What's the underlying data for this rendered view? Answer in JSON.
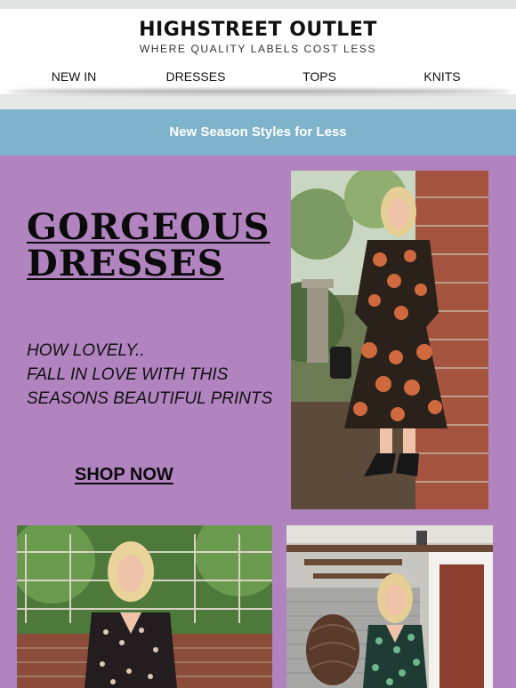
{
  "header": {
    "brand": "HIGHSTREET OUTLET",
    "tagline": "WHERE QUALITY LABELS COST LESS"
  },
  "nav": {
    "items": [
      {
        "label": "NEW IN"
      },
      {
        "label": "DRESSES"
      },
      {
        "label": "TOPS"
      },
      {
        "label": "KNITS"
      }
    ]
  },
  "banner": {
    "text": "New Season Styles for Less"
  },
  "hero": {
    "title_line1": "GORGEOUS",
    "title_line2": "DRESSES",
    "copy_line1": "HOW LOVELY..",
    "copy_line2": "FALL IN LOVE WITH THIS",
    "copy_line3": "SEASONS BEAUTIFUL PRINTS",
    "cta": "SHOP NOW"
  },
  "colors": {
    "hero_background": "#b184c0",
    "banner_background": "#7eb3cb",
    "header_background": "#ffffff"
  }
}
